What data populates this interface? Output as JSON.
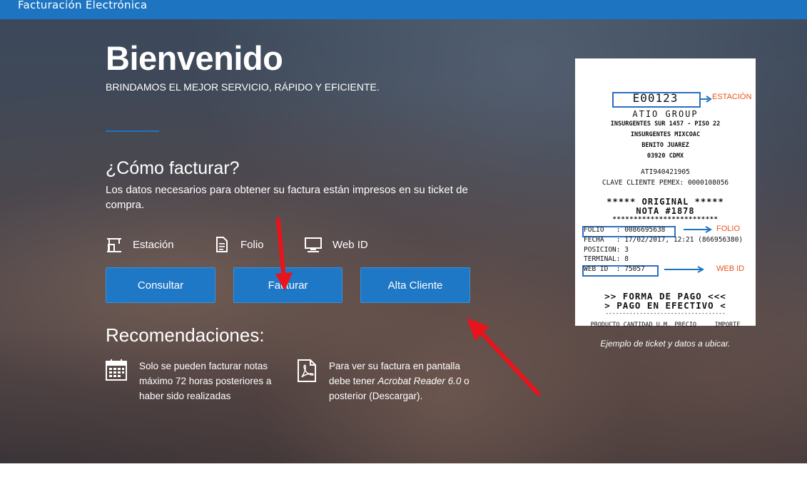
{
  "header": {
    "title": "Facturación Electrónica"
  },
  "hero": {
    "welcome": "Bienvenido",
    "subtitle": "BRINDAMOS EL MEJOR SERVICIO, RÁPIDO Y EFICIENTE.",
    "how_title": "¿Cómo facturar?",
    "how_text": "Los datos necesarios para obtener su factura están impresos en su ticket de compra.",
    "fields": [
      {
        "label": "Estación",
        "icon": "gas-station-icon"
      },
      {
        "label": "Folio",
        "icon": "document-icon"
      },
      {
        "label": "Web ID",
        "icon": "monitor-icon"
      }
    ],
    "buttons": {
      "consultar": "Consultar",
      "facturar": "Facturar",
      "alta_cliente": "Alta Cliente"
    }
  },
  "recommendations": {
    "title": "Recomendaciones:",
    "items": [
      {
        "icon": "calendar-icon",
        "text_lines": [
          "Solo se pueden facturar notas",
          "máximo 72 horas posteriores a",
          "haber sido realizadas"
        ]
      },
      {
        "icon": "pdf-icon",
        "text_before": "Para ver su factura en pantalla",
        "text_mid": "debe tener ",
        "text_italic": "Acrobat Reader 6.0",
        "text_after": " o",
        "text_last": "posterior (Descargar)."
      }
    ]
  },
  "ticket": {
    "station_code": "E00123",
    "station_label": "ESTACIÓN",
    "company": "ATIO GROUP",
    "address1": "INSURGENTES SUR 1457 - PISO 22",
    "address2": "INSURGENTES MIXCOAC",
    "address3": "BENITO JUAREZ",
    "address4": "03920 CDMX",
    "rfc": "ATI940421905",
    "clave": "CLAVE CLIENTE PEMEX: 0000108056",
    "original": "***** ORIGINAL *****",
    "nota": "NOTA #1878",
    "stars": "*************************",
    "folio": "FOLIO   : 0086695638",
    "folio_label": "FOLIO",
    "fecha": "FECHA   : 17/02/2017, 12:21 (866956380)",
    "posicion": "POSICION: 3",
    "terminal": "TERMINAL: 8",
    "webid": "WEB ID  : 75057",
    "webid_label": "WEB ID",
    "forma": ">> FORMA DE PAGO <<<",
    "pago": "> PAGO EN EFECTIVO <",
    "dashes": "-----------------------------------",
    "columns": "PRODUCTO CANTIDAD U.M. PRECIO     IMPORTE",
    "caption": "Ejemplo de ticket y datos a ubicar."
  },
  "colors": {
    "brand_blue": "#1d75c2",
    "annotation_red": "#e8141c",
    "ticket_orange": "#e8541c"
  }
}
